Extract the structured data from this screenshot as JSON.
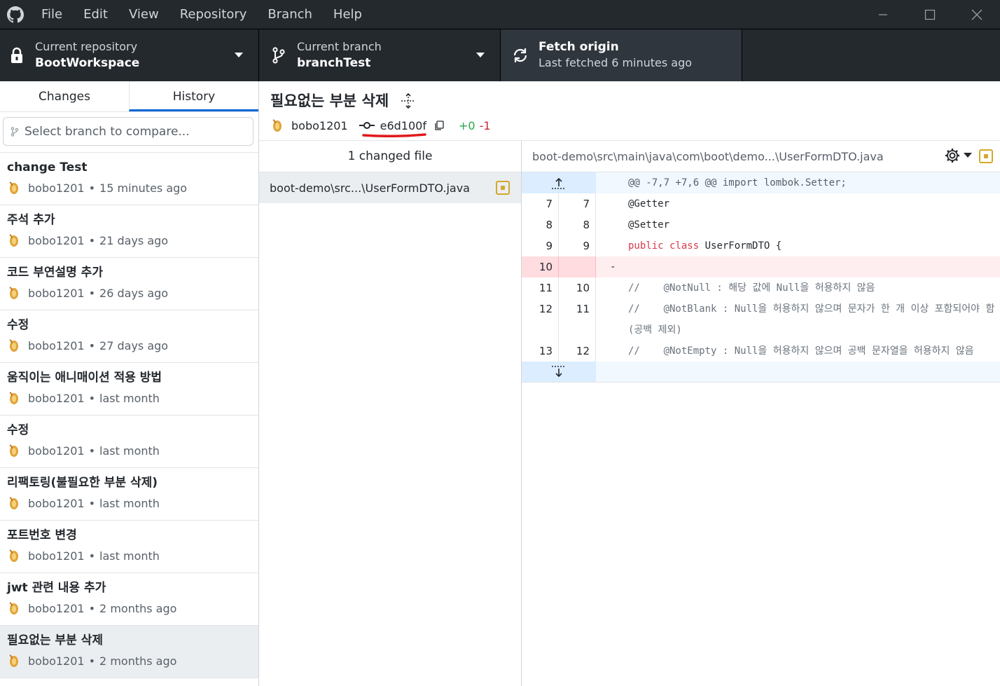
{
  "menu": [
    "File",
    "Edit",
    "View",
    "Repository",
    "Branch",
    "Help"
  ],
  "toolbar": {
    "repo_label": "Current repository",
    "repo_value": "BootWorkspace",
    "branch_label": "Current branch",
    "branch_value": "branchTest",
    "fetch_label": "Fetch origin",
    "fetch_value": "Last fetched 6 minutes ago"
  },
  "tabs": {
    "changes": "Changes",
    "history": "History"
  },
  "compare": {
    "placeholder": "Select branch to compare..."
  },
  "commits": [
    {
      "title": "change Test",
      "author": "bobo1201",
      "time": "15 minutes ago"
    },
    {
      "title": "주석 추가",
      "author": "bobo1201",
      "time": "21 days ago"
    },
    {
      "title": "코드 부연설명 추가",
      "author": "bobo1201",
      "time": "26 days ago"
    },
    {
      "title": "수정",
      "author": "bobo1201",
      "time": "27 days ago"
    },
    {
      "title": "움직이는 애니매이션 적용 방법",
      "author": "bobo1201",
      "time": "last month"
    },
    {
      "title": "수정",
      "author": "bobo1201",
      "time": "last month"
    },
    {
      "title": "리팩토링(불필요한 부분 삭제)",
      "author": "bobo1201",
      "time": "last month"
    },
    {
      "title": "포트번호 변경",
      "author": "bobo1201",
      "time": "last month"
    },
    {
      "title": "jwt 관련 내용 추가",
      "author": "bobo1201",
      "time": "2 months ago"
    },
    {
      "title": "필요없는 부분 삭제",
      "author": "bobo1201",
      "time": "2 months ago"
    }
  ],
  "selected_commit": {
    "summary": "필요없는 부분 삭제",
    "author": "bobo1201",
    "sha": "e6d100f",
    "additions": "+0",
    "deletions": "-1"
  },
  "files": {
    "header": "1 changed file",
    "items": [
      {
        "path": "boot-demo\\src...\\UserFormDTO.java"
      }
    ]
  },
  "diff": {
    "path": "boot-demo\\src\\main\\java\\com\\boot\\demo...\\UserFormDTO.java",
    "hunk": "@@ -7,7 +7,6 @@ import lombok.Setter;",
    "lines": [
      {
        "old": "7",
        "new": "7",
        "text": "@Getter"
      },
      {
        "old": "8",
        "new": "8",
        "text": "@Setter"
      },
      {
        "old": "9",
        "new": "9",
        "kw": "public class",
        "text": " UserFormDTO {"
      },
      {
        "old": "10",
        "new": "",
        "text": "-",
        "type": "del"
      },
      {
        "old": "11",
        "new": "10",
        "text": "//    @NotNull : 해당 값에 Null을 허용하지 않음"
      },
      {
        "old": "12",
        "new": "11",
        "text": "//    @NotBlank : Null을 허용하지 않으며 문자가 한 개 이상 포함되어야 함 (공백 제외)"
      },
      {
        "old": "13",
        "new": "12",
        "text": "//    @NotEmpty : Null을 허용하지 않으며 공백 문자열을 허용하지 않음"
      }
    ]
  }
}
